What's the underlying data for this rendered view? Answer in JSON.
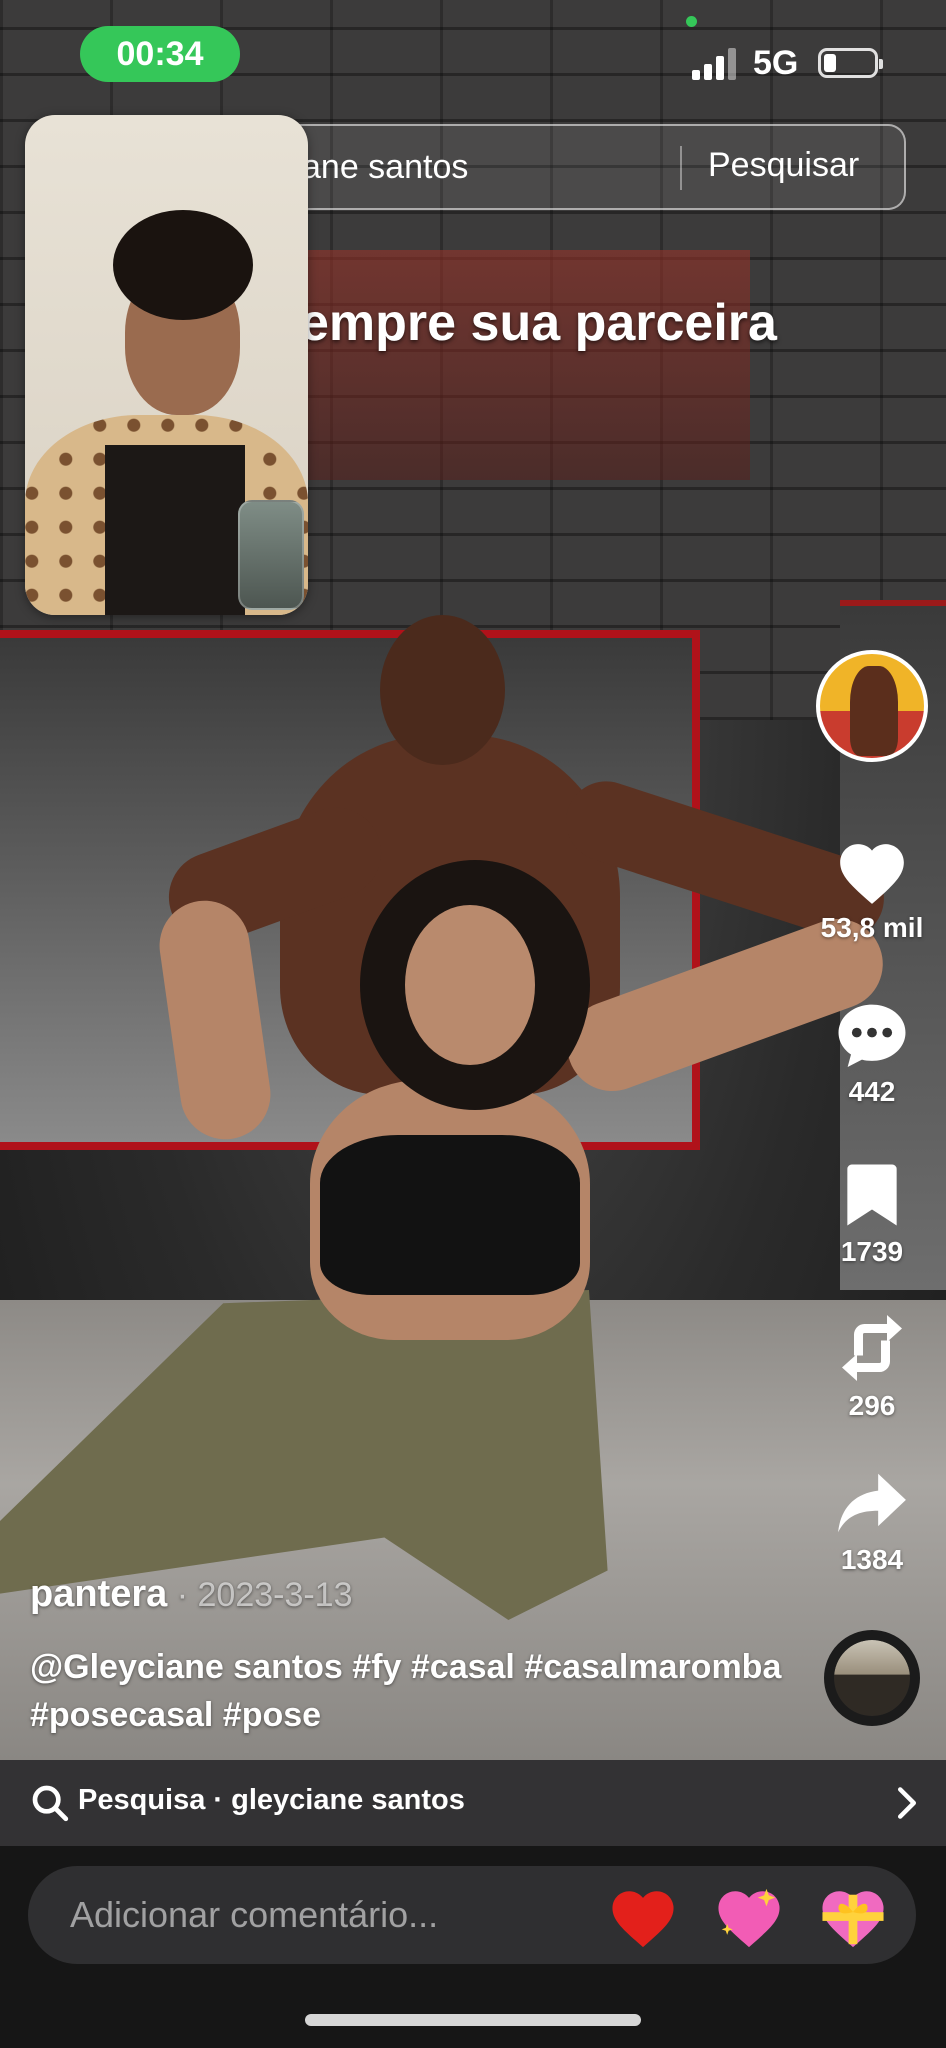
{
  "status_bar": {
    "time": "00:34",
    "network": "5G"
  },
  "search_bar": {
    "query": "ane santos",
    "button_label": "Pesquisar"
  },
  "video": {
    "overlay_text": "empre sua parceira"
  },
  "actions": {
    "like_count": "53,8 mil",
    "comment_count": "442",
    "save_count": "1739",
    "repost_count": "296",
    "share_count": "1384"
  },
  "caption": {
    "author": "pantera",
    "date": " · 2023-3-13",
    "description": "@Gleyciane santos #fy #casal #casalmaromba #posecasal #pose"
  },
  "search_suggestion": {
    "text": "Pesquisa · gleyciane santos"
  },
  "comment_bar": {
    "placeholder": "Adicionar comentário..."
  },
  "icons": [
    "heart-icon",
    "comment-icon",
    "bookmark-icon",
    "repost-icon",
    "share-icon",
    "search-icon",
    "chevron-right-icon"
  ],
  "colors": {
    "time_pill": "#35c759",
    "bottom_bar": "#161616",
    "suggestion_strip": "#333234"
  }
}
